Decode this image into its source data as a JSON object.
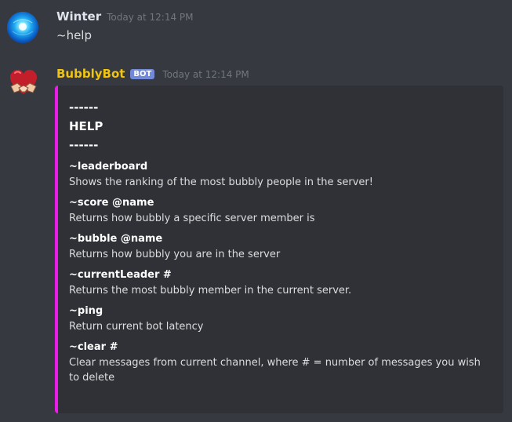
{
  "messages": [
    {
      "author": "Winter",
      "timestamp": "Today at 12:14 PM",
      "content": "~help"
    },
    {
      "author": "BubblyBot",
      "badge": "BOT",
      "timestamp": "Today at 12:14 PM",
      "embed": {
        "accent_color": "#e91ce9",
        "title_lines": [
          "------",
          "HELP",
          "------"
        ],
        "fields": [
          {
            "name": "~leaderboard",
            "value": "Shows the ranking of the most bubbly people in the server!"
          },
          {
            "name": "~score @name",
            "value": "Returns how bubbly a specific server member is"
          },
          {
            "name": "~bubble @name",
            "value": "Returns how bubbly you are in the server"
          },
          {
            "name": "~currentLeader #",
            "value": "Returns the most bubbly member in the current server."
          },
          {
            "name": "~ping",
            "value": "Return current bot latency"
          },
          {
            "name": "~clear #",
            "value": "Clear messages from current channel, where # = number of messages you wish to delete"
          }
        ]
      }
    }
  ],
  "icons": {
    "user_avatar": "blue-orb-avatar",
    "bot_avatar": "heart-handshake-avatar"
  }
}
